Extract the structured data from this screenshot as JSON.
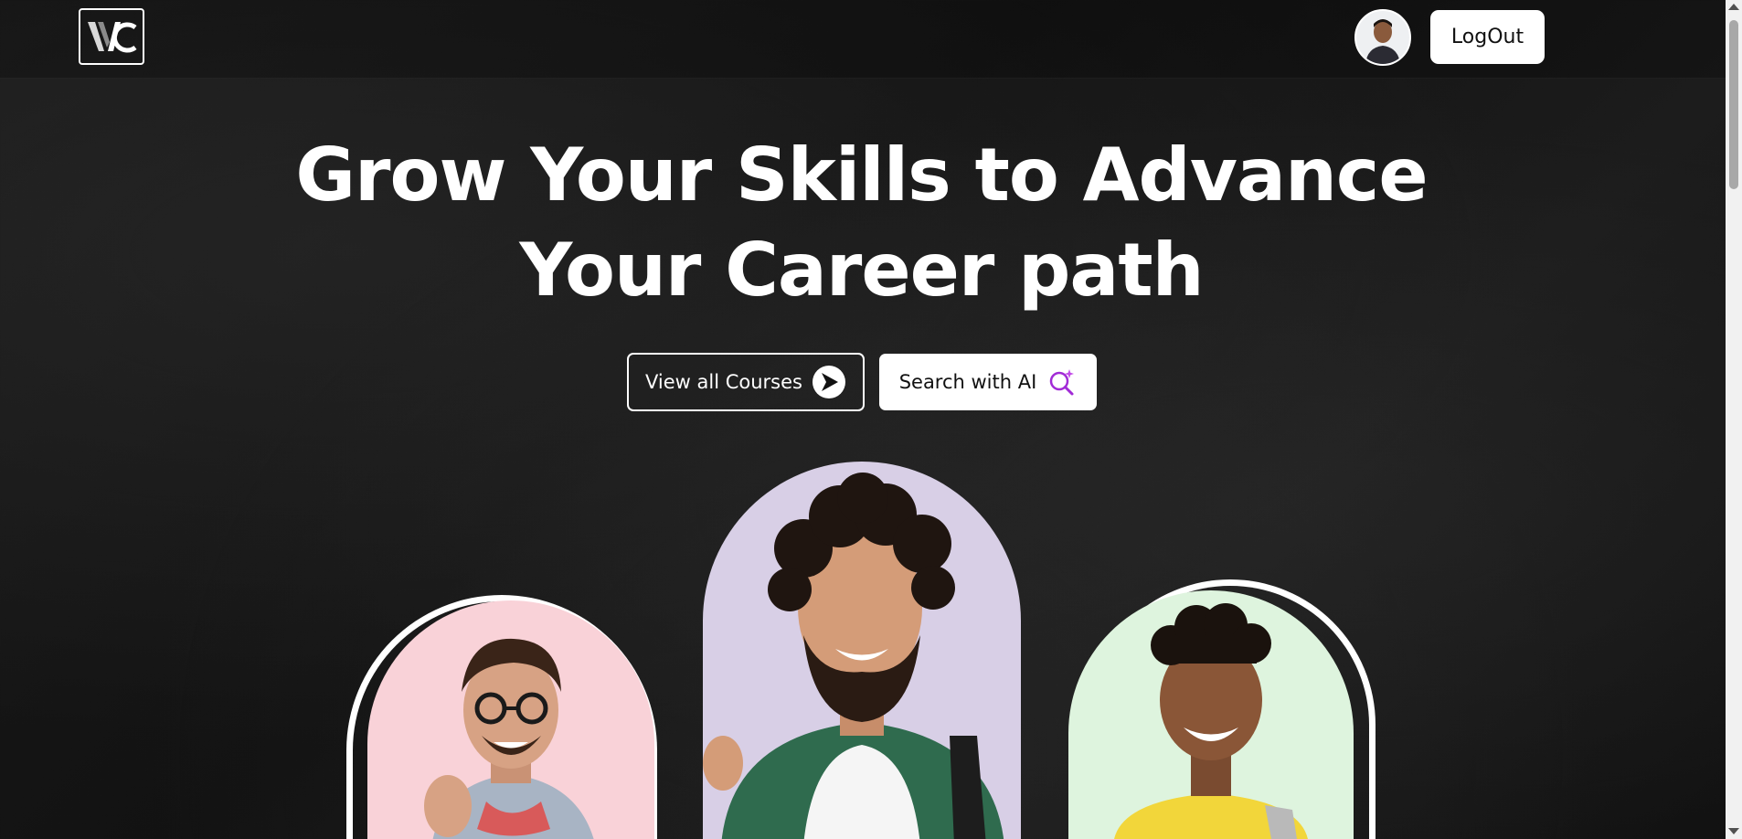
{
  "brand": {
    "logo_text": "VC",
    "logo_icon": "vc-logo-icon"
  },
  "header": {
    "avatar_icon": "user-avatar-icon",
    "logout_label": "LogOut"
  },
  "hero": {
    "title_line1": "Grow Your Skills to Advance",
    "title_line2": "Your Career path",
    "buttons": {
      "courses_label": "View all Courses",
      "courses_icon": "arrow-right-circle-icon",
      "ai_label": "Search with AI",
      "ai_icon": "ai-search-sparkle-icon"
    }
  },
  "people": [
    {
      "name": "student-left",
      "bg": "#f9d2d8"
    },
    {
      "name": "student-center",
      "bg": "#d8cfe6"
    },
    {
      "name": "student-right",
      "bg": "#def4de"
    }
  ],
  "colors": {
    "background": "#161616",
    "text": "#ffffff",
    "button_light": "#ffffff",
    "ai_accent": "#a12bd6"
  }
}
